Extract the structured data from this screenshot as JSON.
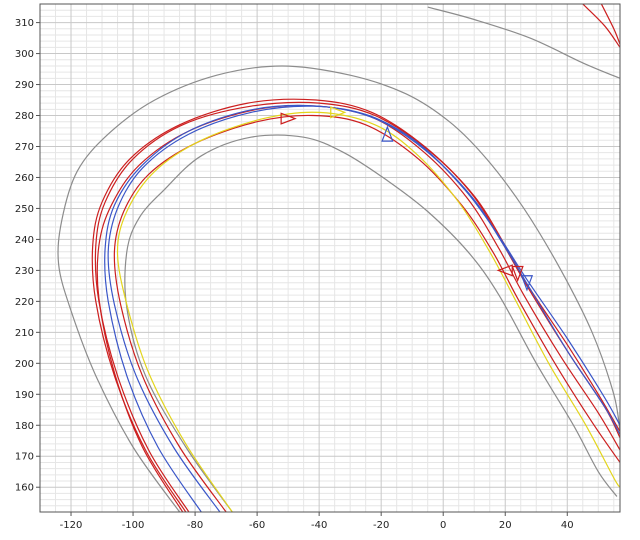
{
  "chart_data": {
    "type": "line",
    "xlim": [
      -130,
      57
    ],
    "ylim": [
      152,
      316
    ],
    "x_ticks": [
      -120,
      -100,
      -80,
      -60,
      -40,
      -20,
      0,
      20,
      40
    ],
    "y_ticks": [
      160,
      170,
      180,
      190,
      200,
      210,
      220,
      230,
      240,
      250,
      260,
      270,
      280,
      290,
      300,
      310
    ],
    "grid": true,
    "colors": {
      "boundary": "#8c8c8c",
      "red": "#cc1f1f",
      "blue": "#3a56c8",
      "yellow": "#e3d51c",
      "grid_major": "#c8c8c8",
      "grid_minor": "#e6e6e6"
    },
    "series": [
      {
        "color": "#8c8c8c",
        "points": [
          [
            -85,
            152
          ],
          [
            -100,
            173
          ],
          [
            -112,
            196
          ],
          [
            -120,
            217
          ],
          [
            -124,
            232
          ],
          [
            -123,
            246
          ],
          [
            -118,
            262
          ],
          [
            -108,
            274
          ],
          [
            -93,
            285
          ],
          [
            -73,
            293
          ],
          [
            -52,
            296
          ],
          [
            -30,
            293
          ],
          [
            -12,
            287
          ],
          [
            2,
            278
          ],
          [
            14,
            266
          ],
          [
            26,
            250
          ],
          [
            38,
            230
          ],
          [
            48,
            210
          ],
          [
            55,
            190
          ],
          [
            57,
            178
          ]
        ]
      },
      {
        "color": "#8c8c8c",
        "points": [
          [
            -68,
            152
          ],
          [
            -83,
            173
          ],
          [
            -96,
            196
          ],
          [
            -102,
            218
          ],
          [
            -102,
            236
          ],
          [
            -98,
            247
          ],
          [
            -90,
            256
          ],
          [
            -78,
            267
          ],
          [
            -62,
            273
          ],
          [
            -45,
            273
          ],
          [
            -32,
            268
          ],
          [
            -18,
            259
          ],
          [
            -5,
            249
          ],
          [
            8,
            236
          ],
          [
            18,
            222
          ],
          [
            30,
            200
          ],
          [
            42,
            180
          ],
          [
            50,
            165
          ],
          [
            56,
            157
          ]
        ]
      },
      {
        "color": "#8c8c8c",
        "points": [
          [
            -5,
            315
          ],
          [
            10,
            311
          ],
          [
            28,
            305
          ],
          [
            45,
            297
          ],
          [
            57,
            292
          ]
        ]
      },
      {
        "color": "#cc1f1f",
        "points": [
          [
            45,
            316
          ],
          [
            52,
            309
          ],
          [
            57,
            302
          ]
        ]
      },
      {
        "color": "#cc1f1f",
        "points": [
          [
            51,
            316
          ],
          [
            55,
            308
          ],
          [
            57,
            303
          ]
        ]
      },
      {
        "color": "#cc1f1f",
        "points": [
          [
            -82,
            152
          ],
          [
            -95,
            172
          ],
          [
            -105,
            196
          ],
          [
            -111,
            220
          ],
          [
            -112,
            238
          ],
          [
            -109,
            252
          ],
          [
            -100,
            266
          ],
          [
            -84,
            277
          ],
          [
            -62,
            283
          ],
          [
            -40,
            284
          ],
          [
            -22,
            280
          ],
          [
            -5,
            269
          ],
          [
            10,
            254
          ],
          [
            20,
            238
          ],
          [
            28,
            224
          ],
          [
            40,
            206
          ],
          [
            50,
            190
          ],
          [
            57,
            178
          ]
        ]
      },
      {
        "color": "#cc1f1f",
        "points": [
          [
            -83,
            152
          ],
          [
            -96,
            172
          ],
          [
            -106,
            196
          ],
          [
            -112,
            220
          ],
          [
            -113,
            238
          ],
          [
            -110,
            252
          ],
          [
            -101,
            266
          ],
          [
            -85,
            277
          ],
          [
            -63,
            284
          ],
          [
            -41,
            285
          ],
          [
            -23,
            281
          ],
          [
            -6,
            270
          ],
          [
            9,
            255
          ],
          [
            19,
            239
          ],
          [
            27,
            225
          ],
          [
            40,
            204
          ],
          [
            52,
            186
          ],
          [
            57,
            176
          ]
        ]
      },
      {
        "color": "#cc1f1f",
        "points": [
          [
            -84,
            152
          ],
          [
            -97,
            173
          ],
          [
            -106,
            197
          ],
          [
            -111,
            221
          ],
          [
            -111,
            238
          ],
          [
            -107,
            251
          ],
          [
            -98,
            264
          ],
          [
            -82,
            275
          ],
          [
            -60,
            282
          ],
          [
            -40,
            283
          ],
          [
            -22,
            279
          ],
          [
            -6,
            268
          ],
          [
            8,
            253
          ],
          [
            18,
            237
          ],
          [
            26,
            222
          ],
          [
            38,
            202
          ],
          [
            50,
            184
          ],
          [
            57,
            172
          ]
        ]
      },
      {
        "color": "#cc1f1f",
        "points": [
          [
            -70,
            152
          ],
          [
            -85,
            173
          ],
          [
            -97,
            196
          ],
          [
            -104,
            219
          ],
          [
            -106,
            236
          ],
          [
            -103,
            249
          ],
          [
            -95,
            261
          ],
          [
            -80,
            271
          ],
          [
            -60,
            278
          ],
          [
            -42,
            280
          ],
          [
            -25,
            277
          ],
          [
            -8,
            266
          ],
          [
            6,
            251
          ],
          [
            16,
            236
          ],
          [
            24,
            221
          ],
          [
            36,
            200
          ],
          [
            48,
            181
          ],
          [
            57,
            168
          ]
        ]
      },
      {
        "color": "#3a56c8",
        "points": [
          [
            -72,
            152
          ],
          [
            -87,
            173
          ],
          [
            -99,
            196
          ],
          [
            -106,
            219
          ],
          [
            -108,
            236
          ],
          [
            -105,
            250
          ],
          [
            -97,
            263
          ],
          [
            -82,
            274
          ],
          [
            -62,
            281
          ],
          [
            -42,
            283
          ],
          [
            -24,
            280
          ],
          [
            -8,
            271
          ],
          [
            7,
            256
          ],
          [
            18,
            241
          ],
          [
            27,
            227
          ],
          [
            40,
            208
          ],
          [
            52,
            189
          ],
          [
            57,
            180
          ]
        ]
      },
      {
        "color": "#3a56c8",
        "points": [
          [
            -78,
            152
          ],
          [
            -92,
            173
          ],
          [
            -102,
            196
          ],
          [
            -108,
            220
          ],
          [
            -109,
            237
          ],
          [
            -106,
            251
          ],
          [
            -97,
            264
          ],
          [
            -82,
            275
          ],
          [
            -61,
            282
          ],
          [
            -40,
            283
          ],
          [
            -22,
            279
          ],
          [
            -6,
            269
          ],
          [
            9,
            254
          ],
          [
            19,
            239
          ],
          [
            28,
            224
          ],
          [
            40,
            204
          ],
          [
            52,
            186
          ],
          [
            57,
            177
          ]
        ]
      },
      {
        "color": "#e3d51c",
        "points": [
          [
            -68,
            152
          ],
          [
            -83,
            174
          ],
          [
            -95,
            197
          ],
          [
            -102,
            219
          ],
          [
            -105,
            236
          ],
          [
            -102,
            249
          ],
          [
            -93,
            262
          ],
          [
            -78,
            272
          ],
          [
            -58,
            279
          ],
          [
            -40,
            281
          ],
          [
            -22,
            277
          ],
          [
            -8,
            267
          ],
          [
            5,
            252
          ],
          [
            15,
            236
          ],
          [
            23,
            221
          ],
          [
            34,
            200
          ],
          [
            46,
            180
          ],
          [
            55,
            163
          ],
          [
            57,
            160
          ]
        ]
      }
    ],
    "markers": [
      {
        "color": "#cc1f1f",
        "x": -50,
        "y": 279,
        "dir": "right"
      },
      {
        "color": "#3a56c8",
        "x": -18,
        "y": 274,
        "dir": "up"
      },
      {
        "color": "#cc1f1f",
        "x": 20,
        "y": 230,
        "dir": "left"
      },
      {
        "color": "#cc1f1f",
        "x": 24,
        "y": 229,
        "dir": "down"
      },
      {
        "color": "#3a56c8",
        "x": 27,
        "y": 226,
        "dir": "down"
      },
      {
        "color": "#e3d51c",
        "x": -34,
        "y": 281,
        "dir": "right"
      }
    ]
  }
}
